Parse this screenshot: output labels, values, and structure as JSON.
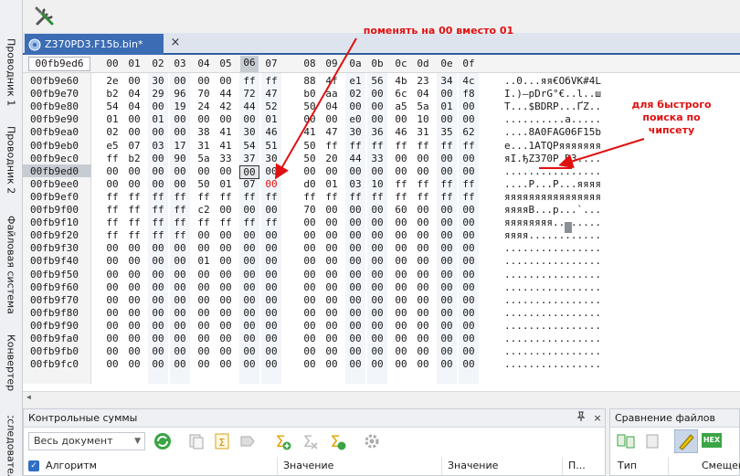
{
  "sidebar": {
    "tabs": [
      "Проводник 1",
      "Проводник 2",
      "Файловая система",
      "Конвертер",
      "Исследователь"
    ]
  },
  "tab": {
    "filename": "Z370PD3.F15b.bin*",
    "close": "×"
  },
  "hex": {
    "header_offset": "00fb9ed6",
    "columns": [
      "00",
      "01",
      "02",
      "03",
      "04",
      "05",
      "06",
      "07",
      "08",
      "09",
      "0a",
      "0b",
      "0c",
      "0d",
      "0e",
      "0f"
    ],
    "selected_column": "06",
    "selected_row_offset": "00fb9ed0",
    "rows": [
      {
        "offset": "00fb9e60",
        "bytes": [
          "2e",
          "00",
          "30",
          "00",
          "00",
          "00",
          "ff",
          "ff",
          "88",
          "4f",
          "e1",
          "56",
          "4b",
          "23",
          "34",
          "4c"
        ],
        "ascii": "..0...яя€OбVK#4L"
      },
      {
        "offset": "00fb9e70",
        "bytes": [
          "b2",
          "04",
          "29",
          "96",
          "70",
          "44",
          "72",
          "47",
          "b0",
          "aa",
          "02",
          "00",
          "6c",
          "04",
          "00",
          "f8"
        ],
        "ascii": "I.)–pDrG°€..l..ш"
      },
      {
        "offset": "00fb9e80",
        "bytes": [
          "54",
          "04",
          "00",
          "19",
          "24",
          "42",
          "44",
          "52",
          "50",
          "04",
          "00",
          "00",
          "a5",
          "5a",
          "01",
          "00"
        ],
        "ascii": "T...$BDRP...ҐZ.."
      },
      {
        "offset": "00fb9e90",
        "bytes": [
          "01",
          "00",
          "01",
          "00",
          "00",
          "00",
          "00",
          "01",
          "00",
          "00",
          "e0",
          "00",
          "00",
          "10",
          "00",
          "00"
        ],
        "ascii": "..........а....."
      },
      {
        "offset": "00fb9ea0",
        "bytes": [
          "02",
          "00",
          "00",
          "00",
          "38",
          "41",
          "30",
          "46",
          "41",
          "47",
          "30",
          "36",
          "46",
          "31",
          "35",
          "62"
        ],
        "ascii": "....8A0FAG06F15b"
      },
      {
        "offset": "00fb9eb0",
        "bytes": [
          "e5",
          "07",
          "03",
          "17",
          "31",
          "41",
          "54",
          "51",
          "50",
          "ff",
          "ff",
          "ff",
          "ff",
          "ff",
          "ff",
          "ff"
        ],
        "ascii": "e...1ATQPяяяяяяя"
      },
      {
        "offset": "00fb9ec0",
        "bytes": [
          "ff",
          "b2",
          "00",
          "90",
          "5a",
          "33",
          "37",
          "30",
          "50",
          "20",
          "44",
          "33",
          "00",
          "00",
          "00",
          "00"
        ],
        "ascii": "яI.ђZ370P D3...."
      },
      {
        "offset": "00fb9ed0",
        "bytes": [
          "00",
          "00",
          "00",
          "00",
          "00",
          "00",
          "00",
          "00",
          "00",
          "00",
          "00",
          "00",
          "00",
          "00",
          "00",
          "00"
        ],
        "ascii": "................"
      },
      {
        "offset": "00fb9ee0",
        "bytes": [
          "00",
          "00",
          "00",
          "00",
          "50",
          "01",
          "07",
          "00",
          "d0",
          "01",
          "03",
          "10",
          "ff",
          "ff",
          "ff",
          "ff"
        ],
        "ascii": "....P...Р...яяяя"
      },
      {
        "offset": "00fb9ef0",
        "bytes": [
          "ff",
          "ff",
          "ff",
          "ff",
          "ff",
          "ff",
          "ff",
          "ff",
          "ff",
          "ff",
          "ff",
          "ff",
          "ff",
          "ff",
          "ff",
          "ff"
        ],
        "ascii": "яяяяяяяяяяяяяяяя"
      },
      {
        "offset": "00fb9f00",
        "bytes": [
          "ff",
          "ff",
          "ff",
          "ff",
          "c2",
          "00",
          "00",
          "00",
          "70",
          "00",
          "00",
          "00",
          "60",
          "00",
          "00",
          "00"
        ],
        "ascii": "яяяяВ...p...`..."
      },
      {
        "offset": "00fb9f10",
        "bytes": [
          "ff",
          "ff",
          "ff",
          "ff",
          "ff",
          "ff",
          "ff",
          "ff",
          "00",
          "00",
          "00",
          "00",
          "00",
          "00",
          "00",
          "00"
        ],
        "ascii": "яяяяяяяя........"
      },
      {
        "offset": "00fb9f20",
        "bytes": [
          "ff",
          "ff",
          "ff",
          "ff",
          "00",
          "00",
          "00",
          "00",
          "00",
          "00",
          "00",
          "00",
          "00",
          "00",
          "00",
          "00"
        ],
        "ascii": "яяяя............"
      },
      {
        "offset": "00fb9f30",
        "bytes": [
          "00",
          "00",
          "00",
          "00",
          "00",
          "00",
          "00",
          "00",
          "00",
          "00",
          "00",
          "00",
          "00",
          "00",
          "00",
          "00"
        ],
        "ascii": "................"
      },
      {
        "offset": "00fb9f40",
        "bytes": [
          "00",
          "00",
          "00",
          "00",
          "01",
          "00",
          "00",
          "00",
          "00",
          "00",
          "00",
          "00",
          "00",
          "00",
          "00",
          "00"
        ],
        "ascii": "................"
      },
      {
        "offset": "00fb9f50",
        "bytes": [
          "00",
          "00",
          "00",
          "00",
          "00",
          "00",
          "00",
          "00",
          "00",
          "00",
          "00",
          "00",
          "00",
          "00",
          "00",
          "00"
        ],
        "ascii": "................"
      },
      {
        "offset": "00fb9f60",
        "bytes": [
          "00",
          "00",
          "00",
          "00",
          "00",
          "00",
          "00",
          "00",
          "00",
          "00",
          "00",
          "00",
          "00",
          "00",
          "00",
          "00"
        ],
        "ascii": "................"
      },
      {
        "offset": "00fb9f70",
        "bytes": [
          "00",
          "00",
          "00",
          "00",
          "00",
          "00",
          "00",
          "00",
          "00",
          "00",
          "00",
          "00",
          "00",
          "00",
          "00",
          "00"
        ],
        "ascii": "................"
      },
      {
        "offset": "00fb9f80",
        "bytes": [
          "00",
          "00",
          "00",
          "00",
          "00",
          "00",
          "00",
          "00",
          "00",
          "00",
          "00",
          "00",
          "00",
          "00",
          "00",
          "00"
        ],
        "ascii": "................"
      },
      {
        "offset": "00fb9f90",
        "bytes": [
          "00",
          "00",
          "00",
          "00",
          "00",
          "00",
          "00",
          "00",
          "00",
          "00",
          "00",
          "00",
          "00",
          "00",
          "00",
          "00"
        ],
        "ascii": "................"
      },
      {
        "offset": "00fb9fa0",
        "bytes": [
          "00",
          "00",
          "00",
          "00",
          "00",
          "00",
          "00",
          "00",
          "00",
          "00",
          "00",
          "00",
          "00",
          "00",
          "00",
          "00"
        ],
        "ascii": "................"
      },
      {
        "offset": "00fb9fb0",
        "bytes": [
          "00",
          "00",
          "00",
          "00",
          "00",
          "00",
          "00",
          "00",
          "00",
          "00",
          "00",
          "00",
          "00",
          "00",
          "00",
          "00"
        ],
        "ascii": "................"
      },
      {
        "offset": "00fb9fc0",
        "bytes": [
          "00",
          "00",
          "00",
          "00",
          "00",
          "00",
          "00",
          "00",
          "00",
          "00",
          "00",
          "00",
          "00",
          "00",
          "00",
          "00"
        ],
        "ascii": "................"
      }
    ]
  },
  "annotations": {
    "top_note": "поменять на 00 вместо 01",
    "right_note_line1": "для быстрого",
    "right_note_line2": "поиска по",
    "right_note_line3": "чипсету",
    "color": "#e01010"
  },
  "checksums": {
    "title": "Контрольные суммы",
    "pin": "📌",
    "close": "×",
    "scope": "Весь документ",
    "columns": [
      "Алгоритм",
      "Значение (Шестнадцатеричное)",
      "Значение (Десятичное)",
      "П..."
    ]
  },
  "compare": {
    "title": "Сравнение файлов",
    "hex_label": "HEX",
    "columns": [
      "Тип",
      "Смещение"
    ]
  },
  "colors": {
    "tab_active": "#3c6cb4",
    "selection": "#c7ccd3",
    "accent_green": "#2f9a3a"
  }
}
